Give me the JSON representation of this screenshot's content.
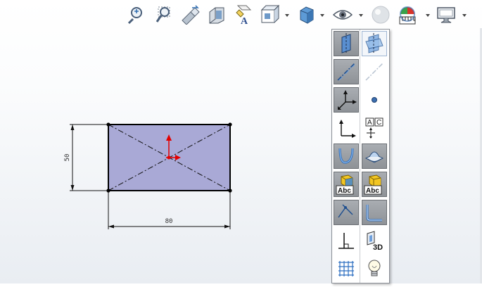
{
  "toolbar": {
    "icons": [
      {
        "name": "zoom-to-fit-icon"
      },
      {
        "name": "zoom-to-area-icon"
      },
      {
        "name": "previous-view-icon"
      },
      {
        "name": "section-view-icon"
      },
      {
        "name": "dynamic-annotation-views-icon"
      },
      {
        "name": "view-orientation-icon",
        "dropdown": true
      },
      {
        "name": "display-style-icon",
        "dropdown": true
      },
      {
        "name": "hide-show-items-icon",
        "dropdown": true
      },
      {
        "name": "edit-appearance-icon"
      },
      {
        "name": "apply-scene-icon",
        "dropdown": true
      },
      {
        "name": "view-settings-icon",
        "dropdown": true
      }
    ]
  },
  "sketch": {
    "height_dimension": "50",
    "width_dimension": "80",
    "colors": {
      "fill": "#a9a9d6",
      "edge": "#000000",
      "origin": "#e30000"
    }
  },
  "hide_show_panel": {
    "buttons": [
      {
        "name": "view-planes-icon",
        "state": "on"
      },
      {
        "name": "view-all-planes-icon",
        "state": "hover"
      },
      {
        "name": "view-axes-icon",
        "state": "on"
      },
      {
        "name": "view-temporary-axes-icon",
        "state": "off"
      },
      {
        "name": "view-origins-icon",
        "state": "on"
      },
      {
        "name": "view-points-icon",
        "state": "on"
      },
      {
        "name": "view-coordinate-systems-icon",
        "state": "on"
      },
      {
        "name": "view-dimension-names-icon",
        "state": "off",
        "text": "A C"
      },
      {
        "name": "view-curves-icon",
        "state": "on"
      },
      {
        "name": "view-surfaces-icon",
        "state": "on"
      },
      {
        "name": "view-annotations-icon",
        "state": "on",
        "text": "Abc"
      },
      {
        "name": "view-all-annotations-icon",
        "state": "on",
        "text": "Abc"
      },
      {
        "name": "view-sketches-icon",
        "state": "on"
      },
      {
        "name": "view-3d-sketch-planes-icon",
        "state": "on"
      },
      {
        "name": "view-sketch-relations-icon",
        "state": "off"
      },
      {
        "name": "view-3d-sketch-icon",
        "state": "off",
        "text": "3D"
      },
      {
        "name": "view-grid-icon",
        "state": "off"
      },
      {
        "name": "view-lights-icon",
        "state": "off"
      }
    ]
  }
}
